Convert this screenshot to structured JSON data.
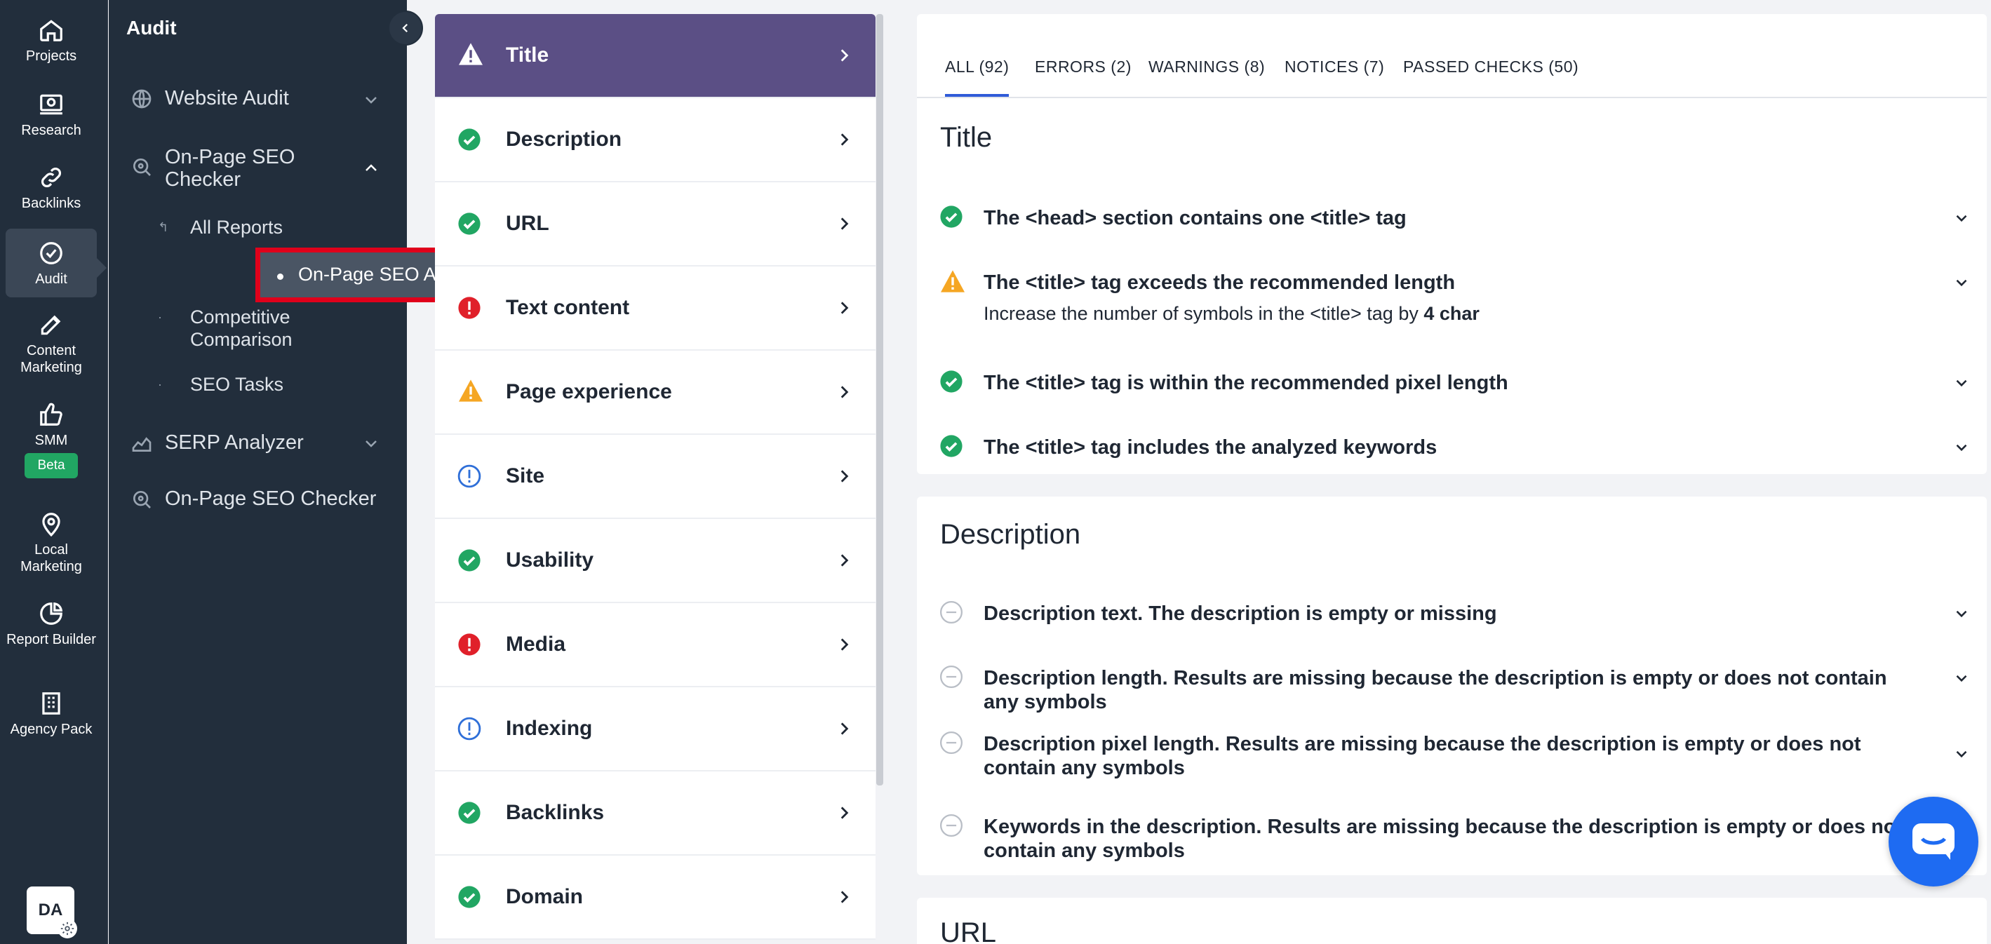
{
  "rail": {
    "items": [
      {
        "label": "Projects",
        "icon": "home-icon"
      },
      {
        "label": "Research",
        "icon": "research-icon"
      },
      {
        "label": "Backlinks",
        "icon": "link-icon"
      },
      {
        "label": "Audit",
        "icon": "check-circle-icon"
      },
      {
        "label": "Content Marketing",
        "icon": "edit-icon"
      },
      {
        "label": "SMM",
        "icon": "thumbs-up-icon"
      },
      {
        "label": "Local Marketing",
        "icon": "map-pin-icon"
      },
      {
        "label": "Report Builder",
        "icon": "pie-chart-icon"
      },
      {
        "label": "Agency Pack",
        "icon": "building-icon"
      }
    ],
    "beta_label": "Beta",
    "avatar_initials": "DA"
  },
  "sidebar": {
    "title": "Audit",
    "website_audit": "Website Audit",
    "onpage_checker": "On-Page SEO Checker",
    "sub_items": [
      "All Reports",
      "On-Page SEO Audit",
      "Competitive Comparison",
      "SEO Tasks"
    ],
    "serp_analyzer": "SERP Analyzer",
    "onpage_checker_2": "On-Page SEO Checker"
  },
  "categories": [
    {
      "label": "Title",
      "status": "warning"
    },
    {
      "label": "Description",
      "status": "pass"
    },
    {
      "label": "URL",
      "status": "pass"
    },
    {
      "label": "Text content",
      "status": "error"
    },
    {
      "label": "Page experience",
      "status": "warning"
    },
    {
      "label": "Site",
      "status": "notice"
    },
    {
      "label": "Usability",
      "status": "pass"
    },
    {
      "label": "Media",
      "status": "error"
    },
    {
      "label": "Indexing",
      "status": "notice"
    },
    {
      "label": "Backlinks",
      "status": "pass"
    },
    {
      "label": "Domain",
      "status": "pass"
    }
  ],
  "tabs": [
    "ALL (92)",
    "ERRORS (2)",
    "WARNINGS (8)",
    "NOTICES (7)",
    "PASSED CHECKS (50)"
  ],
  "title_section": {
    "heading": "Title",
    "checks": [
      {
        "text": "The <head> section contains one <title> tag",
        "status": "pass"
      },
      {
        "text": "The <title> tag exceeds the recommended length",
        "status": "warning",
        "sub_prefix": "Increase the number of symbols in the <title> tag by ",
        "sub_bold": "4 char"
      },
      {
        "text": "The <title> tag is within the recommended pixel length",
        "status": "pass"
      },
      {
        "text": "The <title> tag includes the analyzed keywords",
        "status": "pass"
      }
    ]
  },
  "description_section": {
    "heading": "Description",
    "checks": [
      {
        "text": "Description text. The description is empty or missing",
        "status": "neutral"
      },
      {
        "text": "Description length. Results are missing because the description is empty or does not contain any symbols",
        "status": "neutral"
      },
      {
        "text": "Description pixel length. Results are missing because the description is empty or does not contain any symbols",
        "status": "neutral"
      },
      {
        "text": "Keywords in the description. Results are missing because the description is empty or does not contain any symbols",
        "status": "neutral"
      }
    ]
  },
  "url_section": {
    "heading": "URL"
  },
  "colors": {
    "accent": "#5b4f85",
    "pass": "#21a663",
    "warning": "#f5a623",
    "error": "#e0202a",
    "notice": "#2f6fd8",
    "tab_underline": "#2f5bd8",
    "chat": "#1e6bf2"
  }
}
